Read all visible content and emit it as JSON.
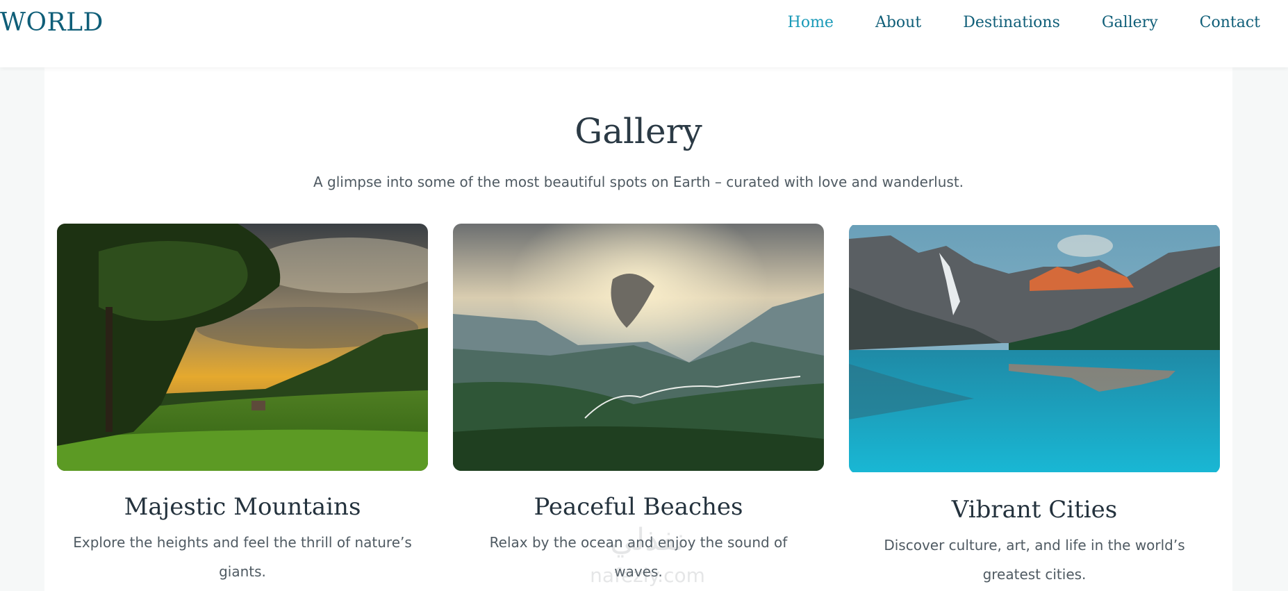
{
  "header": {
    "logo": "WORLD",
    "nav": [
      {
        "label": "Home",
        "active": true
      },
      {
        "label": "About",
        "active": false
      },
      {
        "label": "Destinations",
        "active": false
      },
      {
        "label": "Gallery",
        "active": false
      },
      {
        "label": "Contact",
        "active": false
      }
    ]
  },
  "gallery": {
    "title": "Gallery",
    "subtitle": "A glimpse into some of the most beautiful spots on Earth – curated with love and wanderlust.",
    "cards": [
      {
        "title": "Majestic Mountains",
        "description": "Explore the heights and feel the thrill of nature’s giants."
      },
      {
        "title": "Peaceful Beaches",
        "description": "Relax by the ocean and enjoy the sound of waves."
      },
      {
        "title": "Vibrant Cities",
        "description": "Discover culture, art, and life in the world’s greatest cities."
      }
    ]
  },
  "watermark": {
    "arabic": "نفذلي",
    "latin": "nafezly.com"
  },
  "colors": {
    "brand": "#0f5e78",
    "nav_active": "#1a9ab8",
    "heading": "#2b3a45",
    "body_text": "#4f5a62"
  }
}
